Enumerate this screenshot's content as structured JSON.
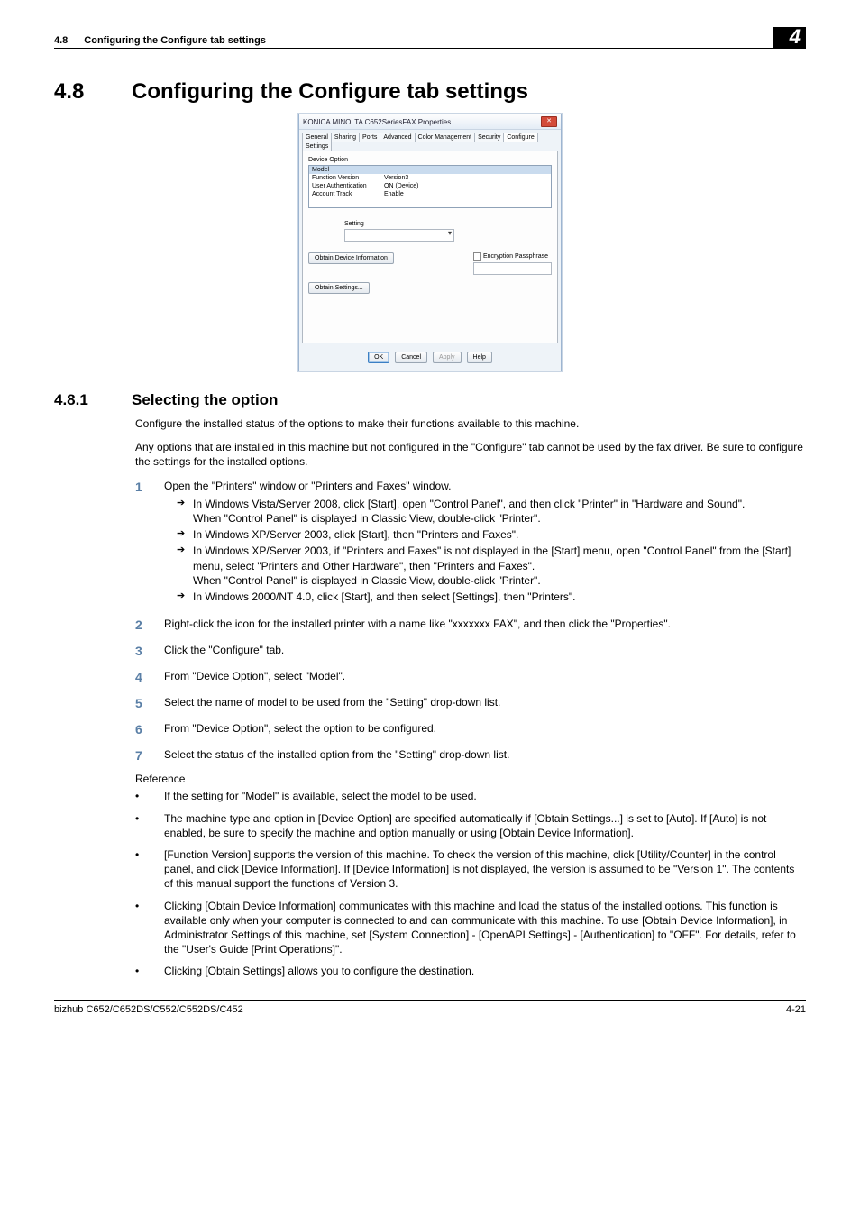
{
  "header": {
    "section_num": "4.8",
    "section_text": "Configuring the Configure tab settings",
    "chapter_badge": "4"
  },
  "h1": {
    "num": "4.8",
    "text": "Configuring the Configure tab settings"
  },
  "dialog": {
    "title": "KONICA MINOLTA C652SeriesFAX Properties",
    "tabs": [
      "General",
      "Sharing",
      "Ports",
      "Advanced",
      "Color Management",
      "Security",
      "Configure",
      "Settings"
    ],
    "active_tab_index": 6,
    "group_label": "Device Option",
    "rows": [
      {
        "name": "Model",
        "value": "",
        "selected": true
      },
      {
        "name": "Function Version",
        "value": "Version3",
        "selected": false
      },
      {
        "name": "User Authentication",
        "value": "ON (Device)",
        "selected": false
      },
      {
        "name": "Account Track",
        "value": "Enable",
        "selected": false
      }
    ],
    "setting_label": "Setting",
    "btn_obtain_info": "Obtain Device Information",
    "encryption_label": "Encryption Passphrase",
    "btn_obtain_settings": "Obtain Settings...",
    "btn_ok": "OK",
    "btn_cancel": "Cancel",
    "btn_apply": "Apply",
    "btn_help": "Help"
  },
  "h2": {
    "num": "4.8.1",
    "text": "Selecting the option"
  },
  "intro": {
    "p1": "Configure the installed status of the options to make their functions available to this machine.",
    "p2": "Any options that are installed in this machine but not configured in the \"Configure\" tab cannot be used by the fax driver. Be sure to configure the settings for the installed options."
  },
  "steps": [
    {
      "num": "1",
      "text": "Open the \"Printers\" window or \"Printers and Faxes\" window.",
      "sub": [
        {
          "a": "In Windows Vista/Server 2008, click [Start], open \"Control Panel\", and then click \"Printer\" in \"Hardware and Sound\".",
          "b": "When \"Control Panel\" is displayed in Classic View, double-click \"Printer\"."
        },
        {
          "a": "In Windows XP/Server 2003, click [Start], then \"Printers and Faxes\"."
        },
        {
          "a": "In Windows XP/Server 2003, if \"Printers and Faxes\" is not displayed in the [Start] menu, open \"Control Panel\" from the [Start] menu, select \"Printers and Other Hardware\", then \"Printers and Faxes\".",
          "b": "When \"Control Panel\" is displayed in Classic View, double-click \"Printer\"."
        },
        {
          "a": "In Windows 2000/NT 4.0, click [Start], and then select [Settings], then \"Printers\"."
        }
      ]
    },
    {
      "num": "2",
      "text": "Right-click the icon for the installed printer with a name like \"xxxxxxx FAX\", and then click the \"Properties\"."
    },
    {
      "num": "3",
      "text": "Click the \"Configure\" tab."
    },
    {
      "num": "4",
      "text": "From \"Device Option\", select \"Model\"."
    },
    {
      "num": "5",
      "text": "Select the name of model to be used from the \"Setting\" drop-down list."
    },
    {
      "num": "6",
      "text": "From \"Device Option\", select the option to be configured."
    },
    {
      "num": "7",
      "text": "Select the status of the installed option from the \"Setting\" drop-down list."
    }
  ],
  "reference_label": "Reference",
  "reference": [
    "If the setting for \"Model\" is available, select the model to be used.",
    "The machine type and option in [Device Option] are specified automatically if [Obtain Settings...] is set to [Auto]. If [Auto] is not enabled, be sure to specify the machine and option manually or using [Obtain Device Information].",
    "[Function Version] supports the version of this machine. To check the version of this machine, click [Utility/Counter] in the control panel, and click [Device Information]. If [Device Information] is not displayed, the version is assumed to be \"Version 1\". The contents of this manual support the functions of Version 3.",
    "Clicking [Obtain Device Information] communicates with this machine and load the status of the installed options. This function is available only when your computer is connected to and can communicate with this machine. To use [Obtain Device Information], in Administrator Settings of this machine, set [System Connection] - [OpenAPI Settings] - [Authentication] to \"OFF\". For details, refer to the \"User's Guide [Print Operations]\".",
    "Clicking [Obtain Settings] allows you to configure the destination."
  ],
  "footer": {
    "left": "bizhub C652/C652DS/C552/C552DS/C452",
    "right": "4-21"
  }
}
